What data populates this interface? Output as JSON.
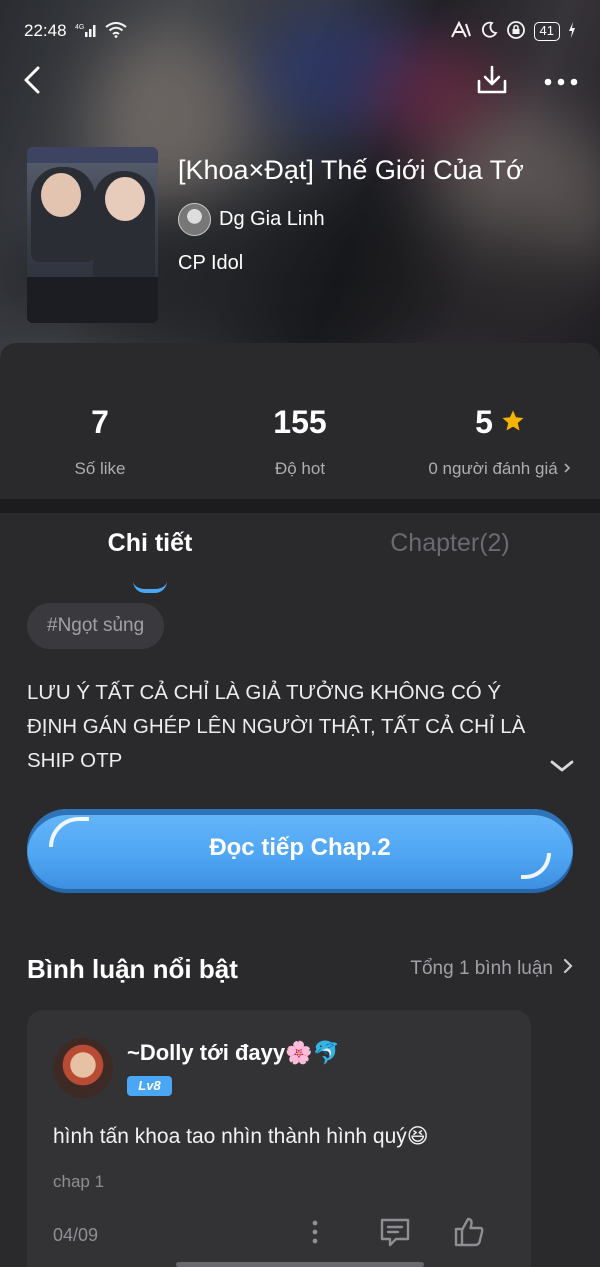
{
  "status_bar": {
    "time": "22:48",
    "network": "4G",
    "battery": "41"
  },
  "header": {
    "back_icon": "chevron-left-icon",
    "download_icon": "download-icon",
    "more_icon": "more-horizontal-icon"
  },
  "story": {
    "title": "[Khoa×Đạt] Thế Giới Của Tớ",
    "author": "Dg Gia Linh",
    "category": "CP Idol"
  },
  "stats": [
    {
      "value": "7",
      "label": "Số like"
    },
    {
      "value": "155",
      "label": "Độ hot"
    },
    {
      "value": "5",
      "label": "0 người đánh giá"
    }
  ],
  "tabs": [
    {
      "label": "Chi tiết",
      "active": true
    },
    {
      "label": "Chapter(2)",
      "active": false
    }
  ],
  "tag": "#Ngọt sủng",
  "description": "LƯU Ý TẤT CẢ CHỈ LÀ GIẢ TƯỞNG KHÔNG CÓ Ý ĐỊNH GÁN GHÉP LÊN NGƯỜI THẬT, TẤT CẢ CHỈ LÀ SHIP OTP",
  "read_button": "Đọc tiếp Chap.2",
  "comments_section": {
    "heading": "Bình luận nổi bật",
    "total": "Tổng 1 bình luận"
  },
  "comment": {
    "user": "~Dolly tới đayy🌸🐬",
    "level": "Lv8",
    "text": "hình tấn khoa tao nhìn thành hình quý😆",
    "chapter": "chap 1",
    "date": "04/09"
  },
  "colors": {
    "accent": "#4aa7f5",
    "background": "#2a2a2d",
    "star": "#f5b400"
  }
}
